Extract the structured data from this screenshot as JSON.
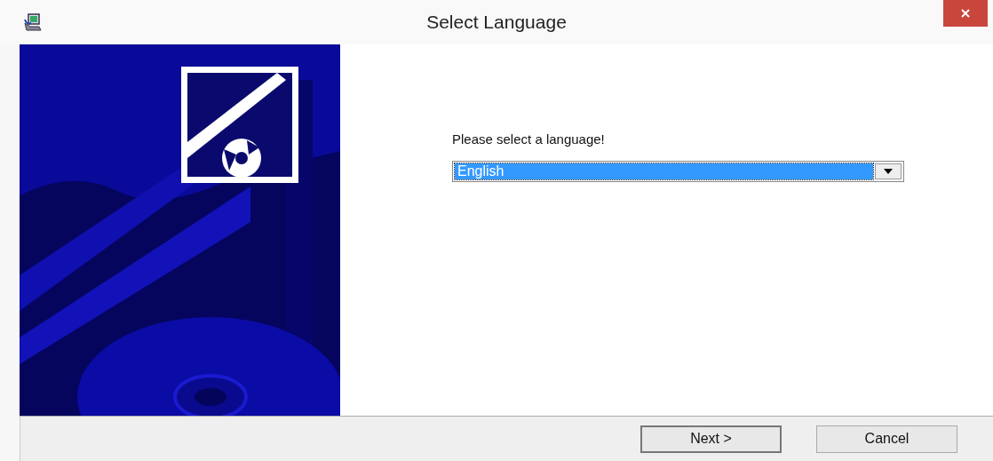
{
  "window": {
    "title": "Select Language"
  },
  "prompt": "Please select a language!",
  "language_dropdown": {
    "value": "English",
    "highlighted": true
  },
  "buttons": [
    {
      "label": "Next >",
      "default": true
    },
    {
      "label": "Cancel",
      "default": false
    }
  ]
}
